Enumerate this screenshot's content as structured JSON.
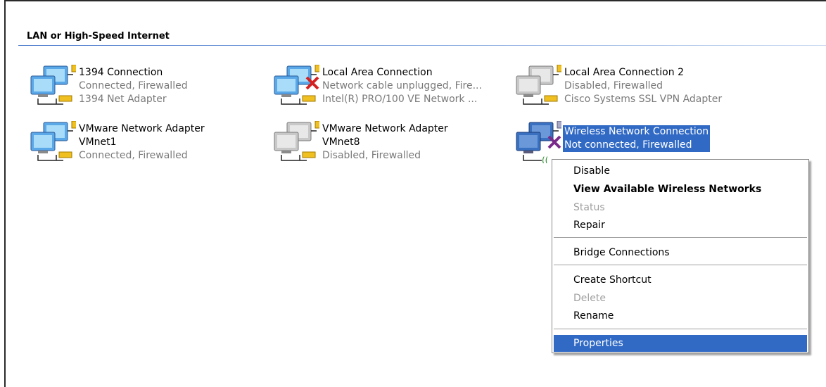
{
  "section": {
    "title": "LAN or High-Speed Internet"
  },
  "connections": [
    {
      "name": "1394 Connection",
      "line2": "Connected, Firewalled",
      "line3": "1394 Net Adapter",
      "icon": "network-connection-icon",
      "state": "connected"
    },
    {
      "name": "Local Area Connection",
      "line2": "Network cable unplugged, Fire...",
      "line3": "Intel(R) PRO/100 VE Network ...",
      "icon": "network-connection-icon",
      "state": "unplugged"
    },
    {
      "name": "Local Area Connection 2",
      "line2": "Disabled, Firewalled",
      "line3": "Cisco Systems SSL VPN Adapter",
      "icon": "network-connection-icon",
      "state": "disabled"
    },
    {
      "name": "VMware Network Adapter",
      "line2": "VMnet1",
      "line3": "Connected, Firewalled",
      "icon": "network-connection-icon",
      "state": "connected"
    },
    {
      "name": "VMware Network Adapter",
      "line2": "VMnet8",
      "line3": "Disabled, Firewalled",
      "icon": "network-connection-icon",
      "state": "disabled"
    },
    {
      "name": "Wireless Network Connection",
      "line2": "Not connected, Firewalled",
      "line3": "",
      "icon": "wireless-connection-icon",
      "state": "not-connected-selected"
    }
  ],
  "context_menu": {
    "items": [
      {
        "label": "Disable",
        "style": "normal"
      },
      {
        "label": "View Available Wireless Networks",
        "style": "bold"
      },
      {
        "label": "Status",
        "style": "disabled"
      },
      {
        "label": "Repair",
        "style": "normal"
      },
      {
        "label": "Bridge Connections",
        "style": "normal"
      },
      {
        "label": "Create Shortcut",
        "style": "normal"
      },
      {
        "label": "Delete",
        "style": "disabled"
      },
      {
        "label": "Rename",
        "style": "normal"
      },
      {
        "label": "Properties",
        "style": "highlighted"
      }
    ]
  },
  "colors": {
    "selection": "#316ac5",
    "disabled_text": "#a0a0a0",
    "status_text": "#7a7a7a",
    "error_x": "#d42020",
    "wireless_x": "#7a2a8a",
    "lock": "#e8b820"
  }
}
